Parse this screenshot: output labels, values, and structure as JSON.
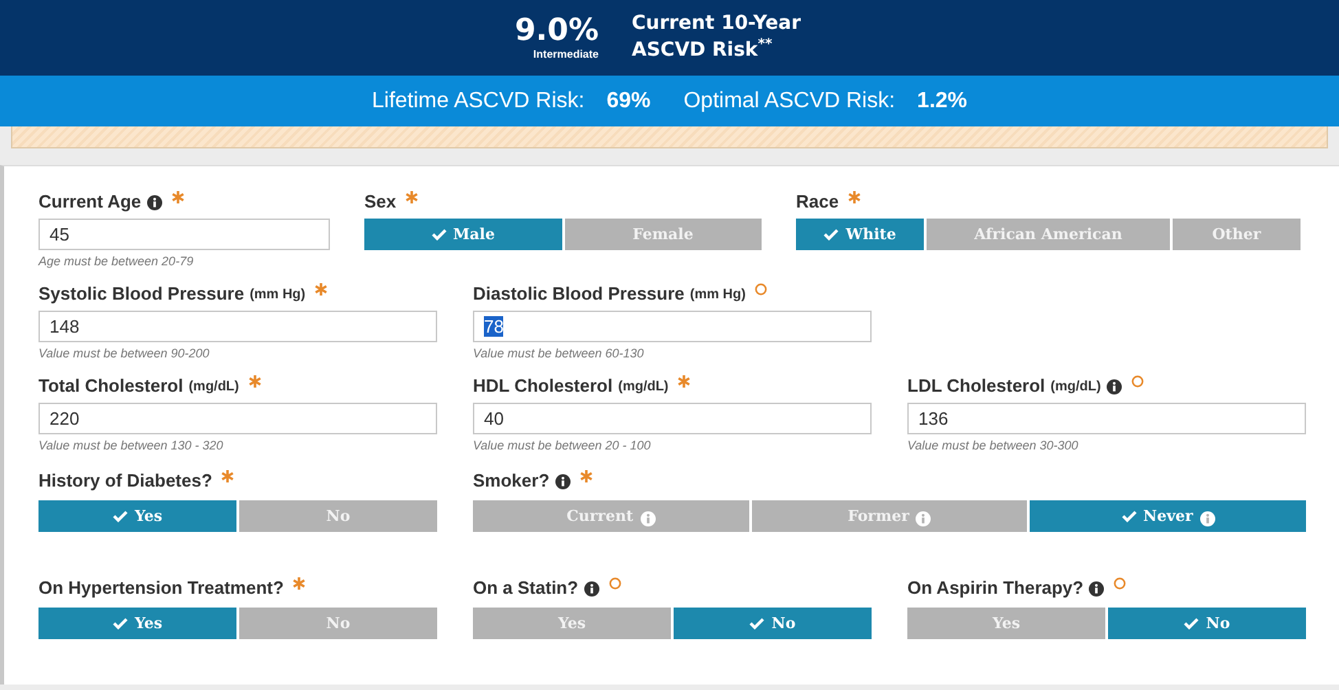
{
  "header": {
    "risk_value": "9.0%",
    "risk_category": "Intermediate",
    "risk_title": "Current 10-Year ASCVD Risk$^{**}$"
  },
  "summary": [
    {
      "label": "Lifetime ASCVD Risk:",
      "value": "69%"
    },
    {
      "label": "Optimal ASCVD Risk:",
      "value": "1.2%"
    }
  ],
  "rows": [
    {
      "items": [
        {
          "kind": "input",
          "label": "Current Age",
          "info": true,
          "required": true,
          "value": "45",
          "highlighted": false,
          "hint": "Age must be between 20-79"
        },
        {
          "kind": "toggle",
          "label": "Sex",
          "info": false,
          "required": true,
          "options": [
            {
              "label": "Male",
              "selected": true,
              "info": false
            },
            {
              "label": "Female",
              "selected": false,
              "info": false
            }
          ]
        },
        {
          "kind": "toggle",
          "label": "Race",
          "info": false,
          "required": true,
          "options": [
            {
              "label": "White",
              "selected": true,
              "info": false
            },
            {
              "label": "African American",
              "selected": false,
              "info": false
            },
            {
              "label": "Other",
              "selected": false,
              "info": false
            }
          ]
        }
      ]
    },
    {
      "items": [
        {
          "kind": "input",
          "label": "Systolic Blood Pressure",
          "unit": "(mm Hg)",
          "info": false,
          "required": true,
          "value": "148",
          "highlighted": false,
          "hint": "Value must be between 90-200"
        },
        {
          "kind": "input",
          "label": "Diastolic Blood Pressure",
          "unit": "(mm Hg)",
          "info": false,
          "required": false,
          "value": "78",
          "highlighted": true,
          "hint": "Value must be between 60-130"
        }
      ]
    },
    {
      "items": [
        {
          "kind": "input",
          "label": "Total Cholesterol",
          "unit": "(mg/dL)",
          "info": false,
          "required": true,
          "value": "220",
          "highlighted": false,
          "hint": "Value must be between 130 - 320"
        },
        {
          "kind": "input",
          "label": "HDL Cholesterol",
          "unit": "(mg/dL)",
          "info": false,
          "required": true,
          "value": "40",
          "highlighted": false,
          "hint": "Value must be between 20 - 100"
        },
        {
          "kind": "input",
          "label": "LDL Cholesterol",
          "unit": "(mg/dL)",
          "info": true,
          "required": false,
          "value": "136",
          "highlighted": false,
          "hint": "Value must be between 30-300"
        }
      ]
    },
    {
      "items": [
        {
          "kind": "toggle",
          "label": "History of Diabetes?",
          "info": false,
          "required": true,
          "options": [
            {
              "label": "Yes",
              "selected": true,
              "info": false
            },
            {
              "label": "No",
              "selected": false,
              "info": false
            }
          ]
        },
        {
          "kind": "toggle",
          "label": "Smoker?",
          "info": true,
          "required": true,
          "options": [
            {
              "label": "Current",
              "selected": false,
              "info": true
            },
            {
              "label": "Former",
              "selected": false,
              "info": true
            },
            {
              "label": "Never",
              "selected": true,
              "info": true
            }
          ]
        }
      ]
    },
    {
      "items": [
        {
          "kind": "toggle",
          "label": "On Hypertension Treatment?",
          "info": false,
          "required": true,
          "options": [
            {
              "label": "Yes",
              "selected": true,
              "info": false
            },
            {
              "label": "No",
              "selected": false,
              "info": false
            }
          ]
        },
        {
          "kind": "toggle",
          "label": "On a Statin?",
          "info": true,
          "required": false,
          "options": [
            {
              "label": "Yes",
              "selected": false,
              "info": false
            },
            {
              "label": "No",
              "selected": true,
              "info": false
            }
          ]
        },
        {
          "kind": "toggle",
          "label": "On Aspirin Therapy?",
          "info": true,
          "required": false,
          "options": [
            {
              "label": "Yes",
              "selected": false,
              "info": false
            },
            {
              "label": "No",
              "selected": true,
              "info": false
            }
          ]
        }
      ]
    }
  ]
}
